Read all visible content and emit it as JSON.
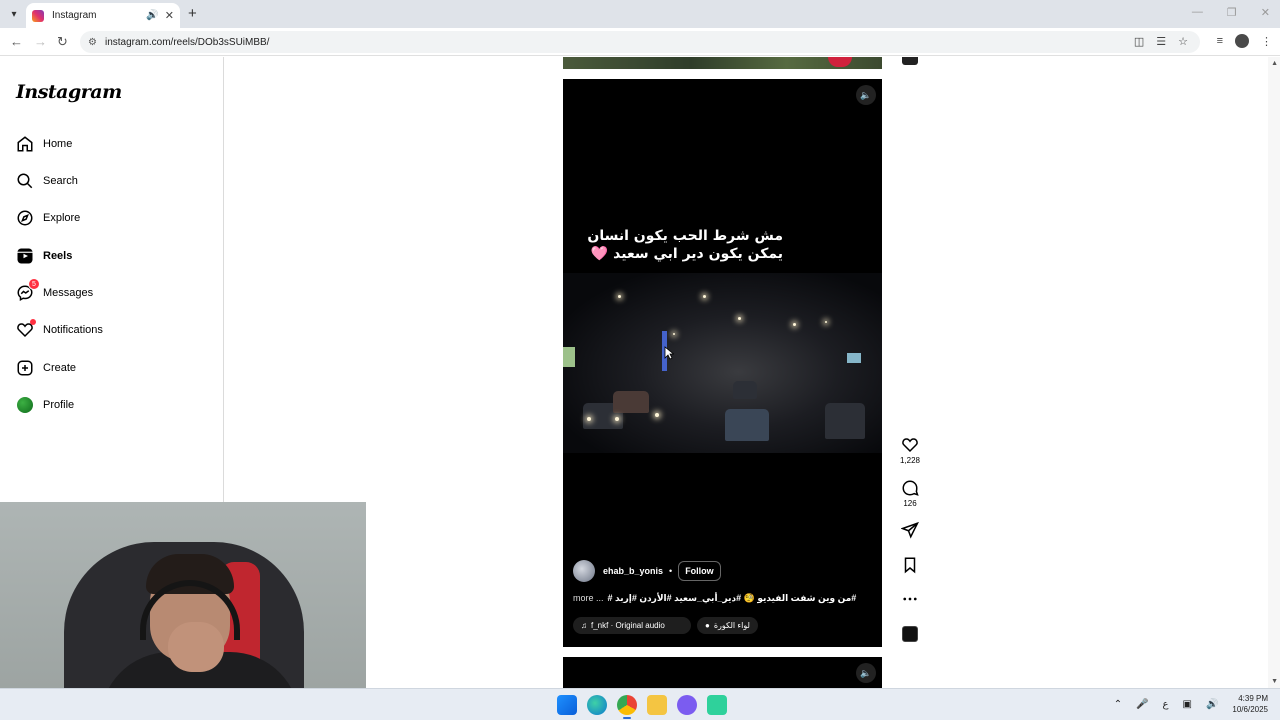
{
  "browser": {
    "tab_title": "Instagram",
    "url": "instagram.com/reels/DOb3sSUiMBB/"
  },
  "sidebar": {
    "logo": "Instagram",
    "items": [
      {
        "label": "Home",
        "icon": "home-icon"
      },
      {
        "label": "Search",
        "icon": "search-icon"
      },
      {
        "label": "Explore",
        "icon": "compass-icon"
      },
      {
        "label": "Reels",
        "icon": "reels-icon"
      },
      {
        "label": "Messages",
        "icon": "messenger-icon",
        "badge": "5"
      },
      {
        "label": "Notifications",
        "icon": "heart-icon"
      },
      {
        "label": "Create",
        "icon": "plus-square-icon"
      },
      {
        "label": "Profile",
        "icon": "avatar-icon"
      }
    ]
  },
  "reel": {
    "overlay_line1": "مش شرط الحب يكون انسان",
    "overlay_line2": "يمكن يكون دير ابي سعيد 🩷",
    "username": "ehab_b_yonis",
    "follow_label": "Follow",
    "caption_more": "more ...",
    "caption_text": "#من وين شفت الفيديو 🧐 #دير_أبي_سعيد #الأردن #إربد #",
    "audio_label": "f_nkf · Original audio",
    "location_label": "لواء الكورة"
  },
  "actions": {
    "likes": "1,228",
    "comments": "126"
  },
  "taskbar": {
    "lang": "ع",
    "time": "4:39 PM",
    "date": "10/6/2025"
  },
  "colors": {
    "accent": "#ff3040",
    "reel_bg": "#000000",
    "sidebar_border": "#dbdbdb"
  }
}
